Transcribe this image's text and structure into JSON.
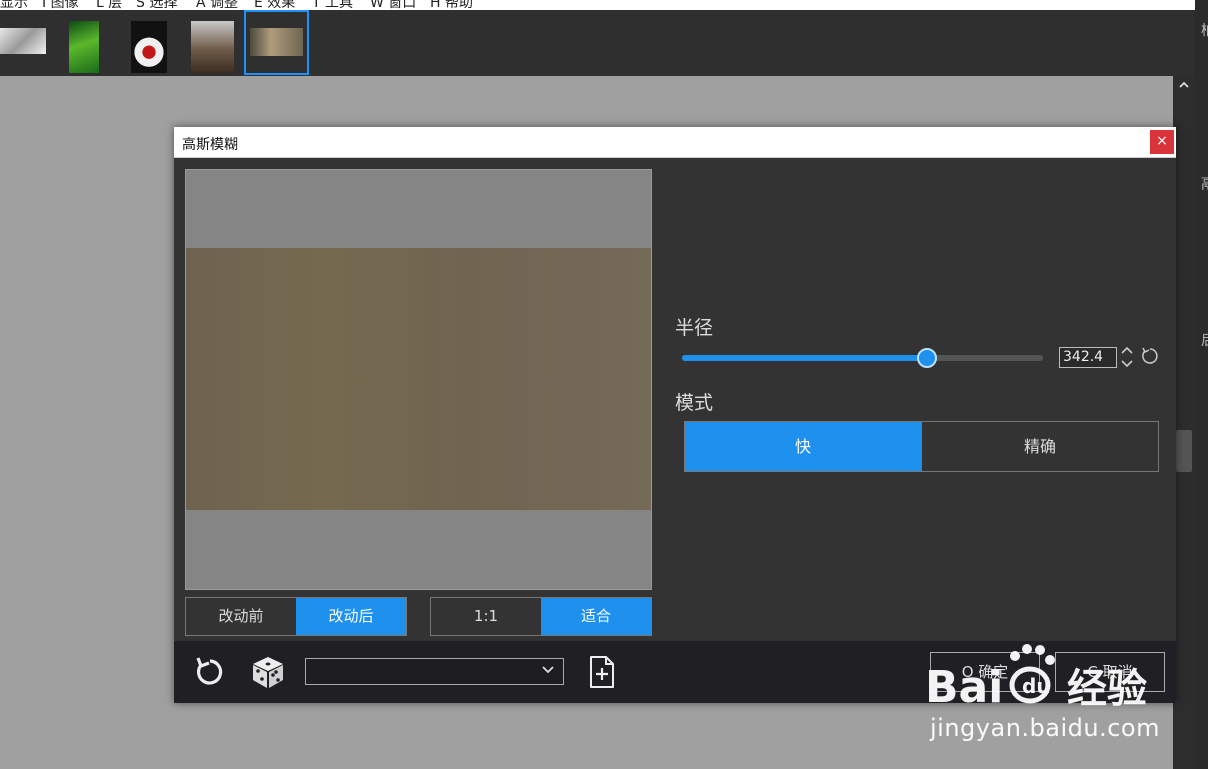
{
  "menubar": {
    "items": [
      "显示",
      "I 图像",
      "L 层",
      "S 选择",
      "A 调整",
      "E 效果",
      "T 工具",
      "W 窗口",
      "H 帮助"
    ]
  },
  "thumbnails": [
    {
      "name": "thumb-1",
      "selected": false
    },
    {
      "name": "thumb-2",
      "selected": false
    },
    {
      "name": "thumb-3",
      "selected": false
    },
    {
      "name": "thumb-4",
      "selected": false
    },
    {
      "name": "thumb-5",
      "selected": true
    }
  ],
  "dialog": {
    "title": "高斯模糊",
    "close_label": "×",
    "radius": {
      "label": "半径",
      "value": "342.4",
      "slider_fraction": 0.68
    },
    "mode": {
      "label": "模式",
      "options": [
        "快",
        "精确"
      ],
      "selected": "快"
    },
    "compare": {
      "options": [
        "改动前",
        "改动后"
      ],
      "selected": "改动后"
    },
    "zoom": {
      "options": [
        "1:1",
        "适合"
      ],
      "selected": "适合"
    },
    "preset_value": "",
    "ok_label": "O 确定",
    "cancel_label": "C 取消"
  },
  "watermark": {
    "url": "jingyan.baidu.com"
  },
  "colors": {
    "accent": "#1e90ee",
    "dialog_bg": "#333333",
    "bottom_bar": "#202024",
    "close": "#d9333b"
  },
  "icons": {
    "reset": "rotate-ccw-icon",
    "random": "dice-icon",
    "preset_add": "file-plus-icon",
    "chevron": "chevron-down-icon"
  }
}
